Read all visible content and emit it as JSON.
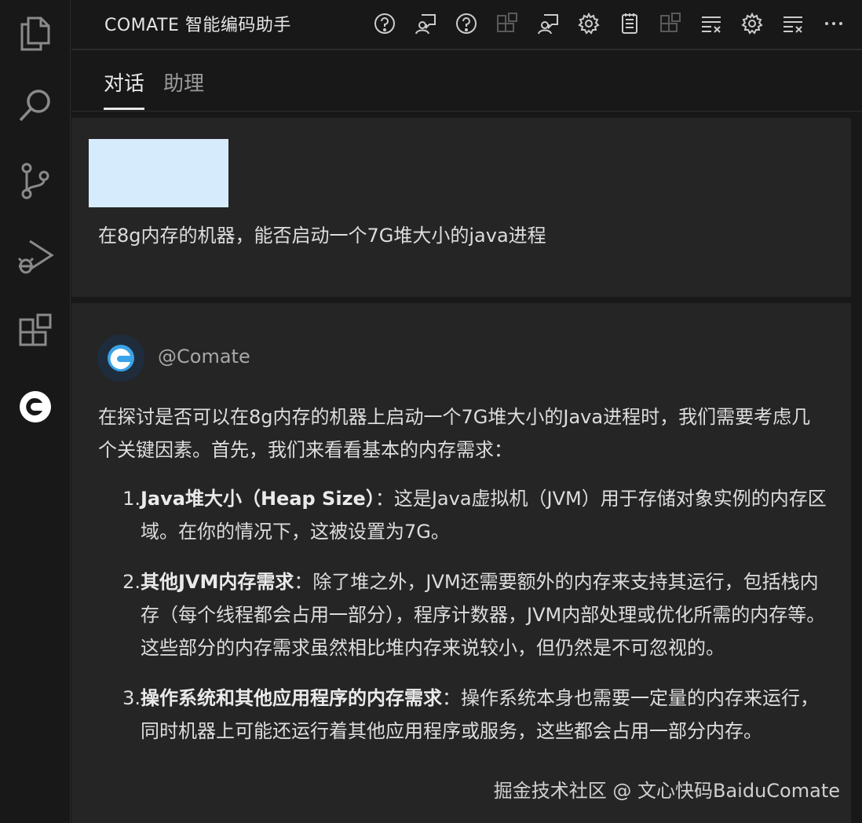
{
  "activity_bar": {
    "items": [
      {
        "icon": "files-icon"
      },
      {
        "icon": "search-icon"
      },
      {
        "icon": "source-control-icon"
      },
      {
        "icon": "run-debug-icon"
      },
      {
        "icon": "extensions-icon"
      },
      {
        "icon": "comate-icon"
      }
    ]
  },
  "panel": {
    "title": "COMATE 智能编码助手",
    "toolbar_icons": [
      "help-icon",
      "chat-user-icon",
      "help-icon",
      "extensions-icon",
      "chat-user-icon",
      "gear-icon",
      "notes-icon",
      "extensions-icon",
      "clear-list-icon",
      "gear-icon",
      "clear-list-icon",
      "more-icon"
    ]
  },
  "tabs": [
    {
      "label": "对话",
      "active": true
    },
    {
      "label": "助理",
      "active": false
    }
  ],
  "user_message": {
    "text": "在8g内存的机器，能否启动一个7G堆大小的java进程"
  },
  "assistant_message": {
    "name": "@Comate",
    "intro": "在探讨是否可以在8g内存的机器上启动一个7G堆大小的Java进程时，我们需要考虑几个关键因素。首先，我们来看看基本的内存需求：",
    "items": [
      {
        "num": "1.",
        "title": "Java堆大小（Heap Size）",
        "text": "：这是Java虚拟机（JVM）用于存储对象实例的内存区域。在你的情况下，这被设置为7G。"
      },
      {
        "num": "2.",
        "title": "其他JVM内存需求",
        "text": "：除了堆之外，JVM还需要额外的内存来支持其运行，包括栈内存（每个线程都会占用一部分），程序计数器，JVM内部处理或优化所需的内存等。这些部分的内存需求虽然相比堆内存来说较小，但仍然是不可忽视的。"
      },
      {
        "num": "3.",
        "title": "操作系统和其他应用程序的内存需求",
        "text": "：操作系统本身也需要一定量的内存来运行，同时机器上可能还运行着其他应用程序或服务，这些都会占用一部分内存。"
      }
    ]
  },
  "watermark": "掘金技术社区 @ 文心快码BaiduComate",
  "colors": {
    "background": "#181818",
    "message_bg": "#252526",
    "attachment": "#d6ebfb",
    "text": "#dddddd"
  }
}
